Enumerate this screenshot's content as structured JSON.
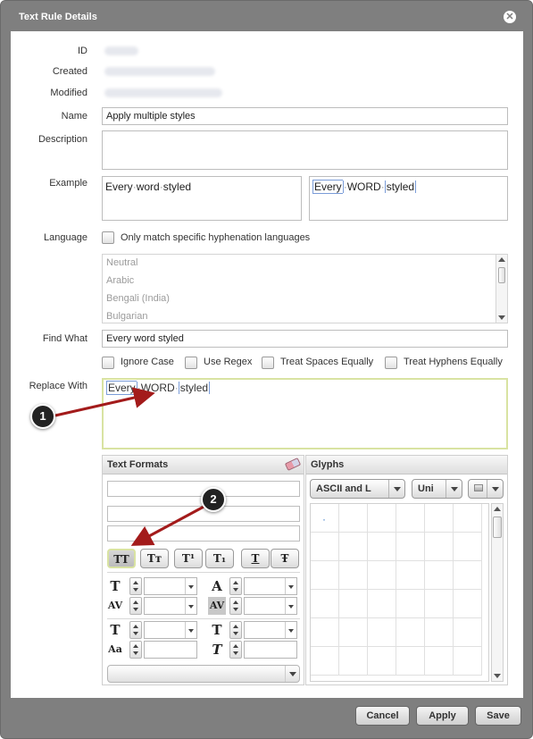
{
  "dialog": {
    "title": "Text Rule Details",
    "close_icon": "close-icon"
  },
  "form": {
    "id_label": "ID",
    "created_label": "Created",
    "modified_label": "Modified",
    "name_label": "Name",
    "name_value": "Apply multiple styles",
    "description_label": "Description",
    "description_value": "",
    "example_label": "Example",
    "example_left_words": [
      "Every",
      "word",
      "styled"
    ],
    "example_right_tokens": [
      "Every",
      "WORD",
      "styled"
    ],
    "language_label": "Language",
    "language_checkbox_label": "Only match specific hyphenation languages",
    "languages": [
      "Neutral",
      "Arabic",
      "Bengali (India)",
      "Bulgarian"
    ],
    "find_what_label": "Find What",
    "find_what_value": "Every word styled",
    "options": [
      "Ignore Case",
      "Use Regex",
      "Treat Spaces Equally",
      "Treat Hyphens Equally"
    ],
    "replace_with_label": "Replace With",
    "replace_tokens": [
      "Every",
      "WORD",
      "styled"
    ]
  },
  "text_formats": {
    "title": "Text Formats",
    "buttons": [
      "TT",
      "Tт",
      "T¹",
      "T₁",
      "T",
      "Ŧ"
    ]
  },
  "glyphs": {
    "title": "Glyphs",
    "set_select": "ASCII and L",
    "encoding_select": "Uni",
    "first_glyph": "·"
  },
  "footer": {
    "cancel": "Cancel",
    "apply": "Apply",
    "save": "Save"
  },
  "callouts": [
    "1",
    "2"
  ],
  "colors": {
    "frame": "#7f7f7f",
    "highlight_border": "#d9e3a2",
    "arrow": "#a31b1b"
  }
}
